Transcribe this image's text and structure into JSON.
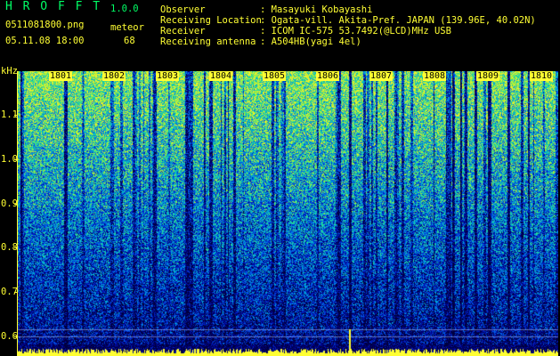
{
  "app": {
    "name": "H R O F F T",
    "version": "1.0.0"
  },
  "file": {
    "name": "0511081800.png",
    "datetime": "05.11.08 18:00"
  },
  "meteor": {
    "label": "meteor",
    "count": "68"
  },
  "info": [
    {
      "key": "Observer",
      "value": ": Masayuki Kobayashi"
    },
    {
      "key": "Receiving Location",
      "value": ": Ogata-vill. Akita-Pref. JAPAN (139.96E, 40.02N)"
    },
    {
      "key": "Receiver",
      "value": ": ICOM IC-575 53.7492(@LCD)MHz USB"
    },
    {
      "key": "Receiving antenna",
      "value": ": A504HB(yagi 4el)"
    }
  ],
  "axis": {
    "unit": "kHz",
    "ticks": [
      "1.1",
      "1.0",
      "0.9",
      "0.8",
      "0.7",
      "0.6"
    ],
    "minutes": [
      "1801",
      "1802",
      "1803",
      "1804",
      "1805",
      "1806",
      "1807",
      "1808",
      "1809",
      "1810"
    ]
  },
  "colors": {
    "background": "#000000",
    "header_green": "#00ff66",
    "text_yellow": "#ffff33",
    "text_white": "#ffffff"
  }
}
